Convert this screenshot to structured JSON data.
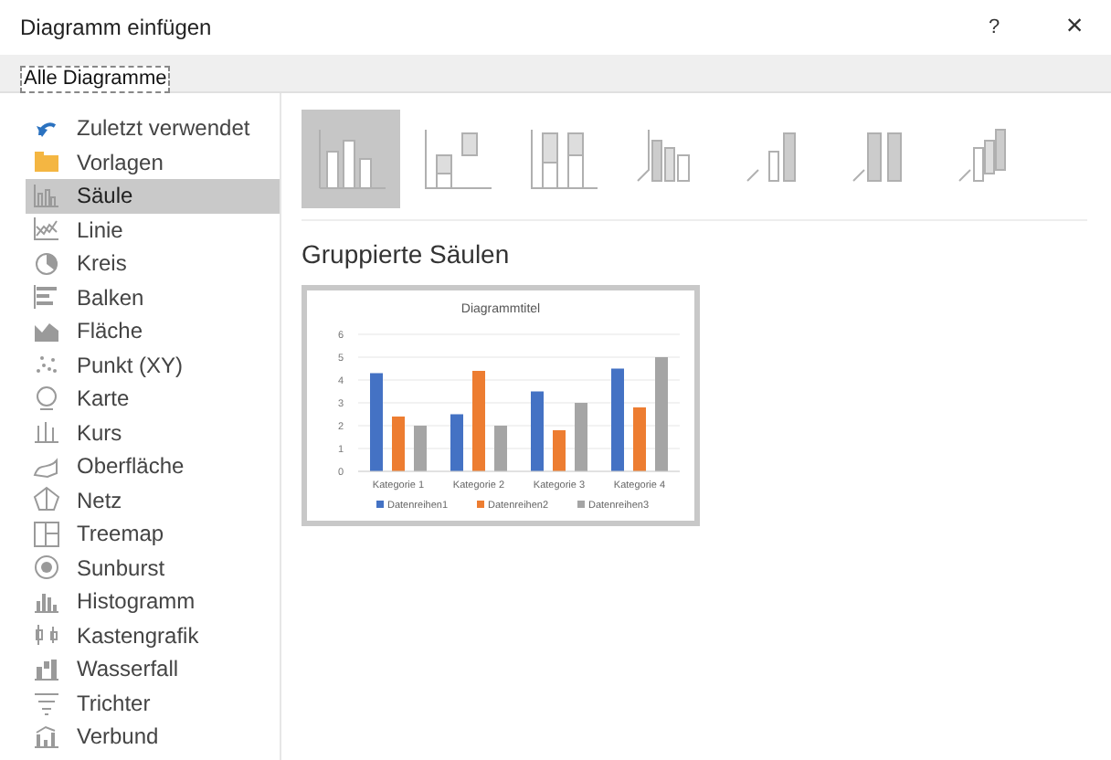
{
  "window": {
    "title": "Diagramm einfügen",
    "help": "?",
    "close": "×"
  },
  "tabs": [
    {
      "label": "Alle Diagramme",
      "selected": true
    }
  ],
  "sidebar": {
    "items": [
      {
        "label": "Zuletzt verwendet",
        "selected": false
      },
      {
        "label": "Vorlagen",
        "selected": false
      },
      {
        "label": "Säule",
        "selected": true
      },
      {
        "label": "Linie",
        "selected": false
      },
      {
        "label": "Kreis",
        "selected": false
      },
      {
        "label": "Balken",
        "selected": false
      },
      {
        "label": "Fläche",
        "selected": false
      },
      {
        "label": "Punkt (XY)",
        "selected": false
      },
      {
        "label": "Karte",
        "selected": false
      },
      {
        "label": "Kurs",
        "selected": false
      },
      {
        "label": "Oberfläche",
        "selected": false
      },
      {
        "label": "Netz",
        "selected": false
      },
      {
        "label": "Treemap",
        "selected": false
      },
      {
        "label": "Sunburst",
        "selected": false
      },
      {
        "label": "Histogramm",
        "selected": false
      },
      {
        "label": "Kastengrafik",
        "selected": false
      },
      {
        "label": "Wasserfall",
        "selected": false
      },
      {
        "label": "Trichter",
        "selected": false
      },
      {
        "label": "Verbund",
        "selected": false
      }
    ]
  },
  "subtypes": [
    {
      "selected": true
    },
    {
      "selected": false
    },
    {
      "selected": false
    },
    {
      "selected": false
    },
    {
      "selected": false
    },
    {
      "selected": false
    },
    {
      "selected": false
    }
  ],
  "subtype_title": "Gruppierte Säulen",
  "preview": {
    "chart_data": {
      "type": "bar",
      "title": "Diagrammtitel",
      "categories": [
        "Kategorie 1",
        "Kategorie 2",
        "Kategorie 3",
        "Kategorie 4"
      ],
      "series": [
        {
          "name": "Datenreihen1",
          "color": "#4472c4",
          "values": [
            4.3,
            2.5,
            3.5,
            4.5
          ]
        },
        {
          "name": "Datenreihen2",
          "color": "#ed7d31",
          "values": [
            2.4,
            4.4,
            1.8,
            2.8
          ]
        },
        {
          "name": "Datenreihen3",
          "color": "#a5a5a5",
          "values": [
            2,
            2,
            3,
            5
          ]
        }
      ],
      "ylim": [
        0,
        6
      ],
      "yticks": [
        0,
        1,
        2,
        3,
        4,
        5,
        6
      ],
      "grid": true,
      "legend": true
    }
  }
}
